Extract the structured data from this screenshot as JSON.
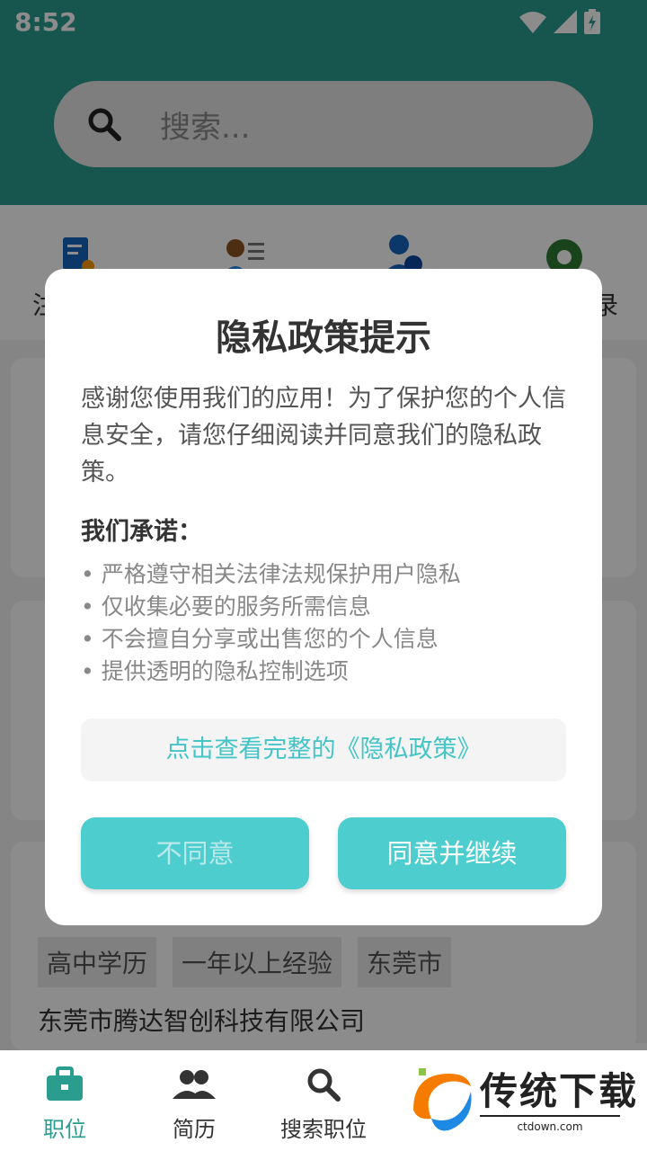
{
  "status_bar": {
    "time": "8:52"
  },
  "search": {
    "placeholder": "搜索..."
  },
  "quick_actions": [
    {
      "label": "注",
      "icon": "resume-doc-icon"
    },
    {
      "label": "",
      "icon": "candidate-list-icon"
    },
    {
      "label": "",
      "icon": "recruit-user-icon"
    },
    {
      "label": "录",
      "icon": "gear-icon"
    }
  ],
  "job_card": {
    "tags": [
      "高中学历",
      "一年以上经验",
      "东莞市"
    ],
    "company": "东莞市腾达智创科技有限公司"
  },
  "bottom_nav": [
    {
      "label": "职位",
      "icon": "briefcase-icon",
      "active": true
    },
    {
      "label": "简历",
      "icon": "people-icon",
      "active": false
    },
    {
      "label": "搜索职位",
      "icon": "search-icon",
      "active": false
    }
  ],
  "watermark": {
    "text": "传统下载",
    "url": "ctdown.com"
  },
  "dialog": {
    "title": "隐私政策提示",
    "description": "感谢您使用我们的应用！为了保护您的个人信息安全，请您仔细阅读并同意我们的隐私政策。",
    "promise_title": "我们承诺：",
    "promises": [
      "• 严格遵守相关法律法规保护用户隐私",
      "• 仅收集必要的服务所需信息",
      "• 不会擅自分享或出售您的个人信息",
      "• 提供透明的隐私控制选项"
    ],
    "policy_link": "点击查看完整的《隐私政策》",
    "disagree_label": "不同意",
    "agree_label": "同意并继续"
  },
  "colors": {
    "primary": "#2a9d8f",
    "button": "#4ecdcf",
    "link": "#43c4c6"
  }
}
